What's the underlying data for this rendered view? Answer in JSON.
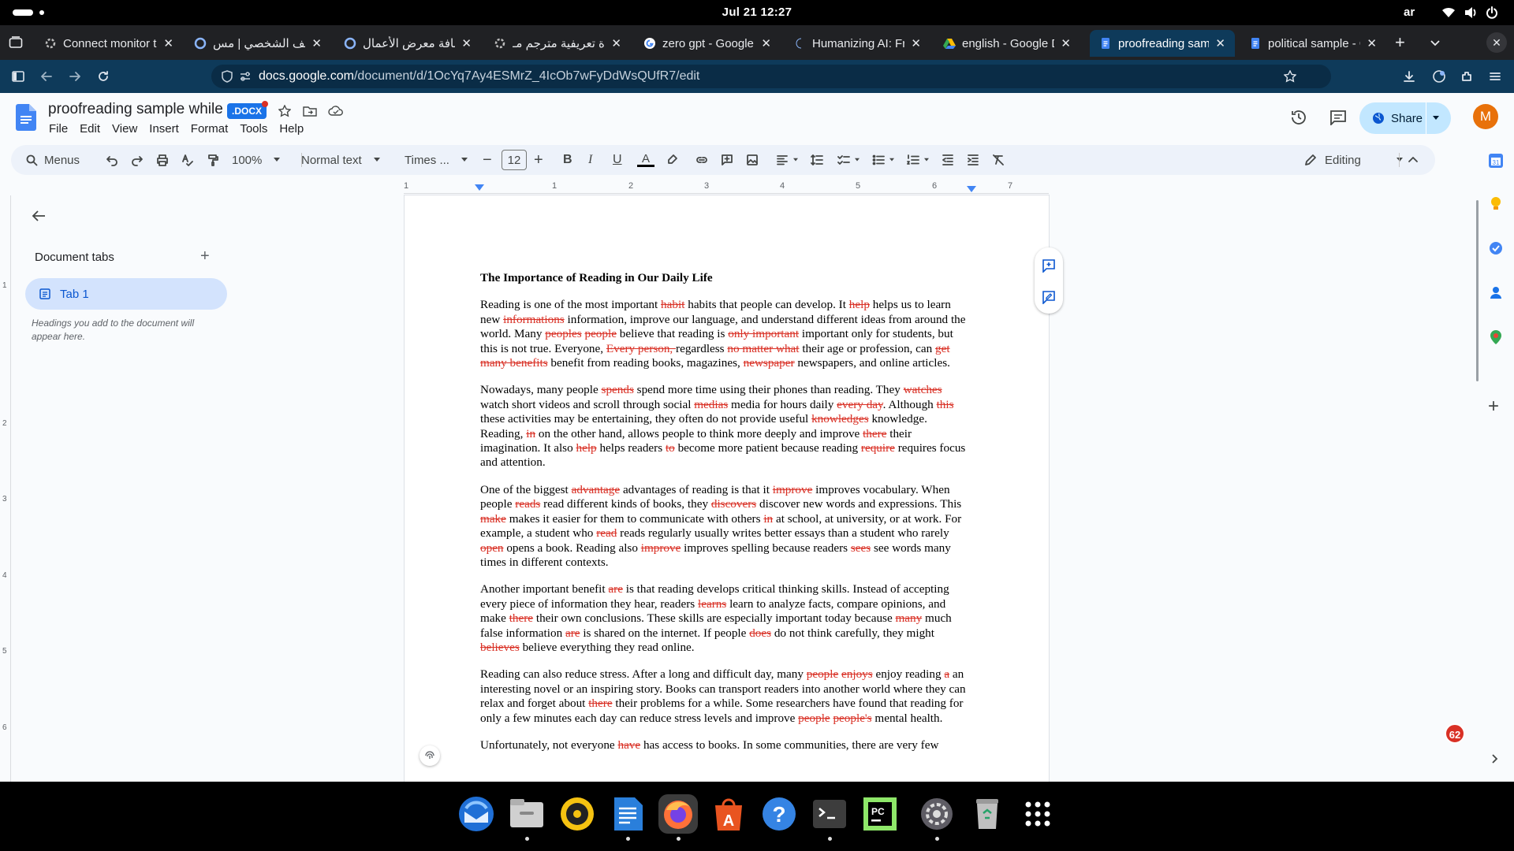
{
  "os": {
    "clock": "Jul 21  12:27",
    "lang": "ar"
  },
  "tabs": [
    {
      "label": "Connect monitor to l",
      "icon": "gear-icon"
    },
    {
      "label": "الملف الشخصي | مس",
      "icon": "upwork-icon"
    },
    {
      "label": "إضافة معرض الأعمال",
      "icon": "upwork-icon"
    },
    {
      "label": "نبذة تعريفية مترجم مـ",
      "icon": "gear-icon"
    },
    {
      "label": "zero gpt - Google Se",
      "icon": "google-icon"
    },
    {
      "label": "Humanizing AI: Free",
      "icon": "moon-icon"
    },
    {
      "label": "english - Google Dri",
      "icon": "drive-icon"
    },
    {
      "label": "proofreading sample",
      "icon": "docs-icon"
    },
    {
      "label": "political sample - Go",
      "icon": "docs-icon"
    }
  ],
  "url": {
    "domain": "docs.google.com",
    "path": "/document/d/1OcYq7Ay4ESMrZ_4IcOb7wFyDdWsQUfR7/edit"
  },
  "doc": {
    "title": "proofreading sample while",
    "badge": ".DOCX",
    "menus": [
      "File",
      "Edit",
      "View",
      "Insert",
      "Format",
      "Tools",
      "Help"
    ],
    "share": "Share",
    "avatar": "M"
  },
  "toolbar": {
    "menus": "Menus",
    "zoom": "100%",
    "style": "Normal text",
    "font": "Times ...",
    "size": "12",
    "mode": "Editing"
  },
  "ruler": [
    "1",
    "1",
    "2",
    "3",
    "4",
    "5",
    "6",
    "7"
  ],
  "vruler": [
    "1",
    "2",
    "3",
    "4",
    "5",
    "6"
  ],
  "sidebar": {
    "title": "Document tabs",
    "tab": "Tab 1",
    "hint": "Headings you add to the document will appear here."
  },
  "notification_count": "62",
  "content": {
    "heading": "The Importance of Reading in Our Daily Life",
    "paragraphs": [
      [
        [
          "t",
          "Reading is one of the most important "
        ],
        [
          "d",
          "habit"
        ],
        [
          "t",
          " habits that people can develop. It "
        ],
        [
          "d",
          "help"
        ],
        [
          "t",
          " helps us to learn new "
        ],
        [
          "d",
          "informations"
        ],
        [
          "t",
          " information, improve our language, and understand different ideas from around the world. Many "
        ],
        [
          "d",
          "peoples"
        ],
        [
          "t",
          " "
        ],
        [
          "d",
          "people"
        ],
        [
          "t",
          " believe that reading is "
        ],
        [
          "d",
          "only important"
        ],
        [
          "t",
          " important only for students, but this is not true. Everyone, "
        ],
        [
          "d",
          "Every person, "
        ],
        [
          "t",
          " regardless "
        ],
        [
          "d",
          "no matter what"
        ],
        [
          "t",
          " their age or profession, can "
        ],
        [
          "d",
          "get many benefits"
        ],
        [
          "t",
          " benefit from reading books, magazines, "
        ],
        [
          "d",
          "newspaper"
        ],
        [
          "t",
          " newspapers, and online articles."
        ]
      ],
      [
        [
          "t",
          "Nowadays, many people "
        ],
        [
          "d",
          "spends"
        ],
        [
          "t",
          " spend more time using their phones than reading. They "
        ],
        [
          "d",
          "watches"
        ],
        [
          "t",
          " watch short videos and scroll through social "
        ],
        [
          "d",
          "medias"
        ],
        [
          "t",
          " media for hours daily "
        ],
        [
          "d",
          "every day"
        ],
        [
          "t",
          ". Although "
        ],
        [
          "d",
          "this"
        ],
        [
          "t",
          " these activities may be entertaining, they often do not provide useful "
        ],
        [
          "d",
          "knowledges"
        ],
        [
          "t",
          " knowledge. Reading, "
        ],
        [
          "d",
          "in"
        ],
        [
          "t",
          " on the other hand, allows people to think more deeply and improve "
        ],
        [
          "d",
          "there"
        ],
        [
          "t",
          " their imagination. It also "
        ],
        [
          "d",
          "help"
        ],
        [
          "t",
          " helps readers "
        ],
        [
          "d",
          "to"
        ],
        [
          "t",
          " become more patient because reading "
        ],
        [
          "d",
          "require"
        ],
        [
          "t",
          " requires focus and attention."
        ]
      ],
      [
        [
          "t",
          "One of the biggest "
        ],
        [
          "d",
          "advantage"
        ],
        [
          "t",
          " advantages of reading is that it "
        ],
        [
          "d",
          "improve"
        ],
        [
          "t",
          " improves vocabulary. When people "
        ],
        [
          "d",
          "reads"
        ],
        [
          "t",
          " read different kinds of books, they "
        ],
        [
          "d",
          "discovers"
        ],
        [
          "t",
          " discover new words and expressions. This "
        ],
        [
          "d",
          "make"
        ],
        [
          "t",
          " makes it easier for them to communicate with others "
        ],
        [
          "d",
          "in"
        ],
        [
          "t",
          " at school, at university, or at work. For example, a student who "
        ],
        [
          "d",
          "read"
        ],
        [
          "t",
          " reads regularly usually writes better essays than a student who rarely "
        ],
        [
          "d",
          "open"
        ],
        [
          "t",
          " opens a book. Reading also "
        ],
        [
          "d",
          "improve"
        ],
        [
          "t",
          " improves spelling because readers "
        ],
        [
          "d",
          "sees"
        ],
        [
          "t",
          " see words many times in different contexts."
        ]
      ],
      [
        [
          "t",
          "Another important benefit "
        ],
        [
          "d",
          "are"
        ],
        [
          "t",
          " is that reading develops critical thinking skills. Instead of accepting every piece of information they hear, readers "
        ],
        [
          "d",
          "learns"
        ],
        [
          "t",
          " learn to analyze facts, compare opinions, and make "
        ],
        [
          "d",
          "there"
        ],
        [
          "t",
          " their own conclusions. These skills are especially important today because "
        ],
        [
          "d",
          "many"
        ],
        [
          "t",
          " much false information "
        ],
        [
          "d",
          "are"
        ],
        [
          "t",
          " is shared on the internet. If people "
        ],
        [
          "d",
          "does"
        ],
        [
          "t",
          " do not think carefully, they might "
        ],
        [
          "d",
          "believes"
        ],
        [
          "t",
          " believe everything they read online."
        ]
      ],
      [
        [
          "t",
          "Reading can also reduce stress. After a long and difficult day, many "
        ],
        [
          "d",
          "people"
        ],
        [
          "t",
          " "
        ],
        [
          "d",
          "enjoys"
        ],
        [
          "t",
          " enjoy reading "
        ],
        [
          "d",
          "a"
        ],
        [
          "t",
          " an interesting novel or an inspiring story. Books can transport readers into another world where they can relax and forget about "
        ],
        [
          "d",
          "there"
        ],
        [
          "t",
          " their problems for a while. Some researchers have found that reading for only a few minutes each day can reduce stress levels and improve "
        ],
        [
          "d",
          "people"
        ],
        [
          "t",
          " "
        ],
        [
          "d",
          "people's"
        ],
        [
          "t",
          " mental health."
        ]
      ],
      [
        [
          "t",
          "Unfortunately, not everyone "
        ],
        [
          "d",
          "have"
        ],
        [
          "t",
          " has access to books. In some communities, there are very few"
        ]
      ]
    ]
  },
  "dock": [
    "thunderbird-icon",
    "files-icon",
    "rhythmbox-icon",
    "writer-icon",
    "firefox-icon",
    "appcenter-icon",
    "help-icon",
    "terminal-icon",
    "pycharm-icon",
    "settings-icon",
    "trash-icon",
    "apps-grid-icon"
  ]
}
